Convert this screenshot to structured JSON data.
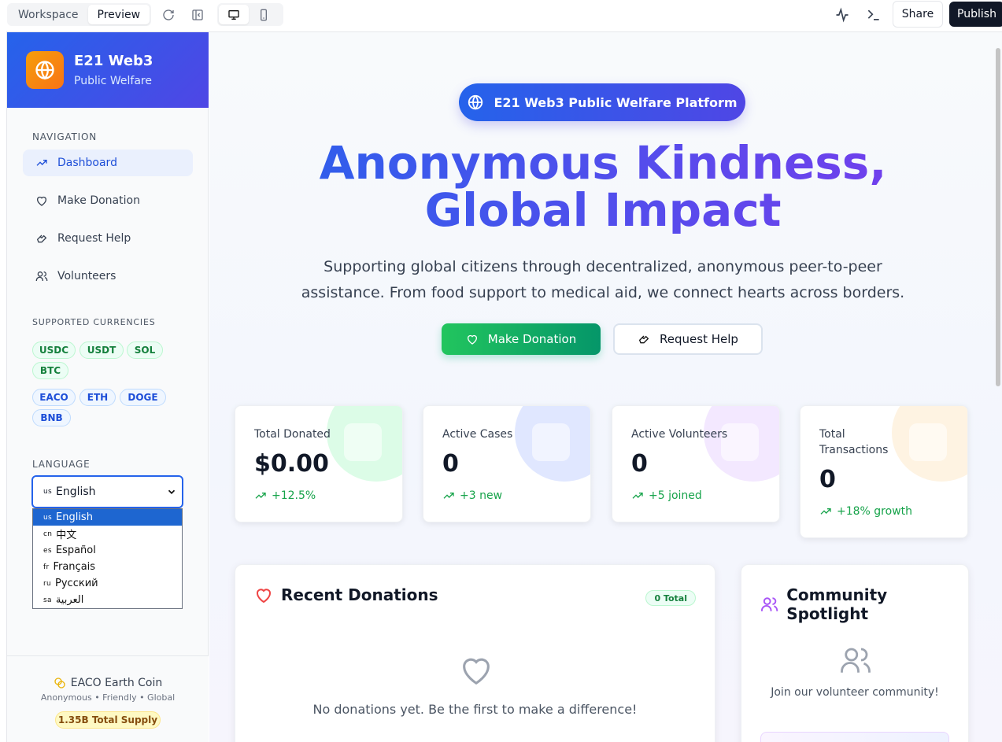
{
  "topbar": {
    "workspace_label": "Workspace",
    "preview_label": "Preview",
    "share_label": "Share",
    "publish_label": "Publish"
  },
  "sidebar": {
    "brand_title": "E21 Web3",
    "brand_subtitle": "Public Welfare",
    "nav_heading": "NAVIGATION",
    "nav": [
      {
        "label": "Dashboard",
        "icon": "trending-up-icon"
      },
      {
        "label": "Make Donation",
        "icon": "heart-icon"
      },
      {
        "label": "Request Help",
        "icon": "hand-icon"
      },
      {
        "label": "Volunteers",
        "icon": "users-icon"
      }
    ],
    "currencies_heading": "SUPPORTED CURRENCIES",
    "currencies_green": [
      "USDC",
      "USDT",
      "SOL",
      "BTC"
    ],
    "currencies_blue": [
      "EACO",
      "ETH",
      "DOGE",
      "BNB"
    ],
    "language_heading": "LANGUAGE",
    "language_selected": {
      "flag": "us",
      "label": "English"
    },
    "language_options": [
      {
        "flag": "us",
        "label": "English"
      },
      {
        "flag": "cn",
        "label": "中文"
      },
      {
        "flag": "es",
        "label": "Español"
      },
      {
        "flag": "fr",
        "label": "Français"
      },
      {
        "flag": "ru",
        "label": "Русский"
      },
      {
        "flag": "sa",
        "label": "العربية"
      }
    ],
    "footer": {
      "title": "EACO Earth Coin",
      "subtitle": "Anonymous • Friendly • Global",
      "badge": "1.35B Total Supply"
    }
  },
  "hero": {
    "pill": "E21 Web3 Public Welfare Platform",
    "title_line1": "Anonymous Kindness,",
    "title_line2": "Global Impact",
    "desc_line1": "Supporting global citizens through decentralized, anonymous peer-to-peer",
    "desc_line2": "assistance. From food support to medical aid, we connect hearts across borders.",
    "donate_label": "Make Donation",
    "help_label": "Request Help"
  },
  "stats": [
    {
      "label": "Total Donated",
      "value": "$0.00",
      "trend": "+12.5%",
      "color": "#dcfce7"
    },
    {
      "label": "Active Cases",
      "value": "0",
      "trend": "+3 new",
      "color": "#e0e7ff"
    },
    {
      "label": "Active Volunteers",
      "value": "0",
      "trend": "+5 joined",
      "color": "#f3e8ff"
    },
    {
      "label": "Total Transactions",
      "value": "0",
      "trend": "+18% growth",
      "color": "#fef3e2"
    }
  ],
  "donations": {
    "title": "Recent Donations",
    "badge": "0 Total",
    "empty": "No donations yet. Be the first to make a difference!"
  },
  "spotlight": {
    "title": "Community Spotlight",
    "empty": "Join our volunteer community!"
  },
  "colors": {
    "accent": "#2563eb",
    "green": "#16a34a",
    "purple": "#7c3aed"
  }
}
